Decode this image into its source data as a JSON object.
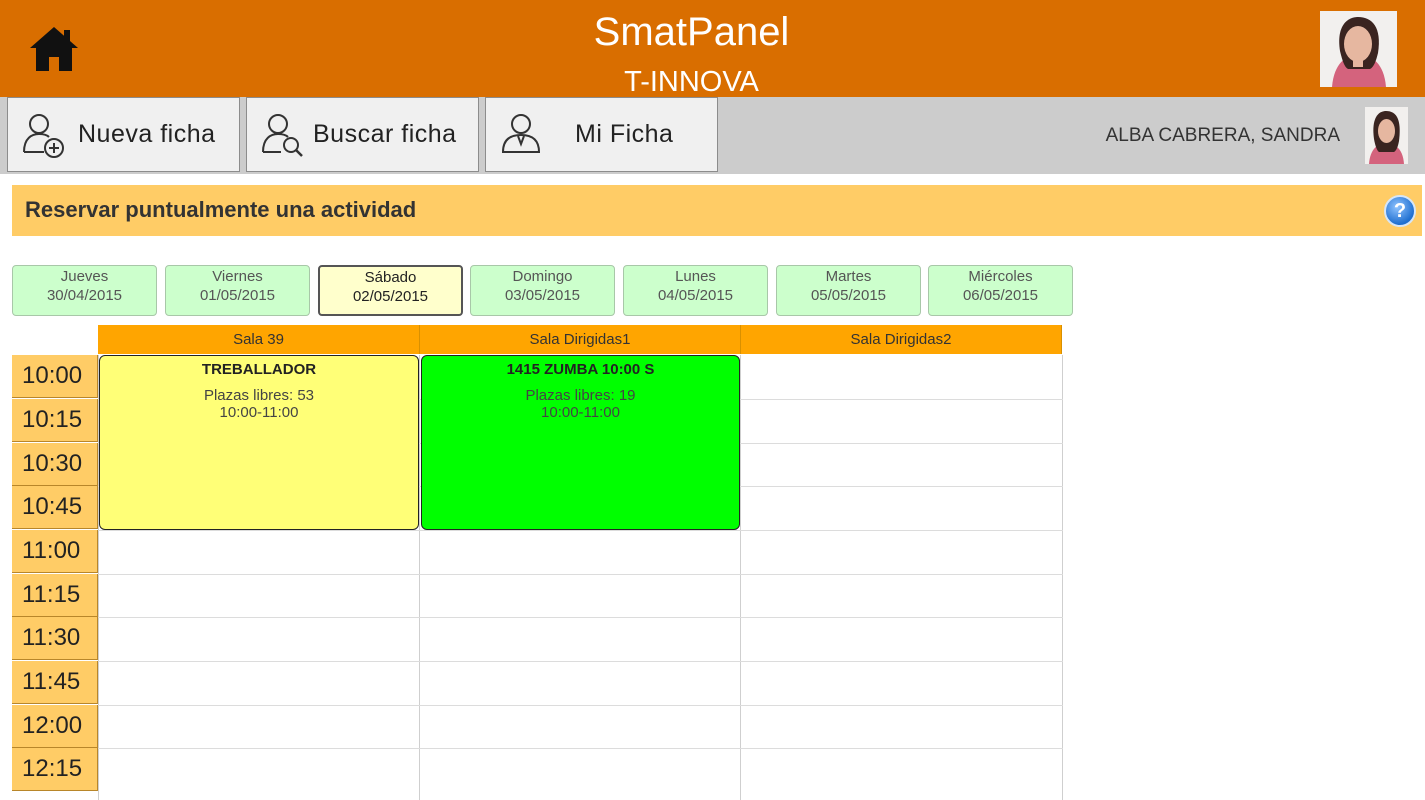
{
  "header": {
    "title": "SmatPanel",
    "subtitle": "T-INNOVA",
    "home_icon": "home-icon",
    "avatar_icon": "user-photo"
  },
  "toolbar": {
    "new_record_label": "Nueva ficha",
    "search_record_label": "Buscar ficha",
    "my_record_label": "Mi Ficha",
    "user_name": "ALBA CABRERA, SANDRA"
  },
  "section": {
    "title": "Reservar puntualmente una actividad",
    "help_label": "?"
  },
  "days": [
    {
      "name": "Jueves",
      "date": "30/04/2015"
    },
    {
      "name": "Viernes",
      "date": "01/05/2015"
    },
    {
      "name": "Sábado",
      "date": "02/05/2015"
    },
    {
      "name": "Domingo",
      "date": "03/05/2015"
    },
    {
      "name": "Lunes",
      "date": "04/05/2015"
    },
    {
      "name": "Martes",
      "date": "05/05/2015"
    },
    {
      "name": "Miércoles",
      "date": "06/05/2015"
    }
  ],
  "selected_day": "Sábado",
  "rooms": [
    "Sala 39",
    "Sala Dirigidas1",
    "Sala Dirigidas2"
  ],
  "times": [
    "10:00",
    "10:15",
    "10:30",
    "10:45",
    "11:00",
    "11:15",
    "11:30",
    "11:45",
    "12:00",
    "12:15"
  ],
  "activities": [
    {
      "name": "TREBALLADOR",
      "places": "Plazas libres: 53",
      "time": "10:00-11:00",
      "color": "#FFFF77"
    },
    {
      "name": "1415 ZUMBA 10:00 S",
      "places": "Plazas libres: 19",
      "time": "10:00-11:00",
      "color": "#00FF00"
    }
  ],
  "colors": {
    "header": "#D96E00",
    "toolbar": "#CCCCCC",
    "section": "#FFCC66",
    "room_header": "#FFA500",
    "time_cell": "#FFCC66",
    "day_tab": "#CCFFCC",
    "day_tab_active": "#FFFFCC"
  }
}
